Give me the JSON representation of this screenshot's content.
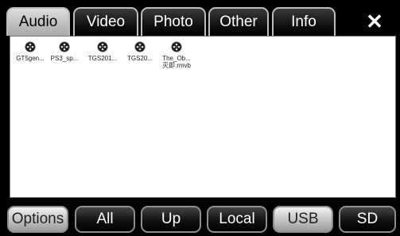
{
  "tabs": [
    {
      "label": "Audio",
      "active": true
    },
    {
      "label": "Video",
      "active": false
    },
    {
      "label": "Photo",
      "active": false
    },
    {
      "label": "Other",
      "active": false
    },
    {
      "label": "Info",
      "active": false
    }
  ],
  "close_label": "✕",
  "files": [
    {
      "name": "GT5gen..."
    },
    {
      "name": "PS3_sp..."
    },
    {
      "name": "TGS201..."
    },
    {
      "name": "TGS20..."
    },
    {
      "name": "The_Ob...",
      "name_line2": "灭即.rmvb"
    }
  ],
  "bottom_buttons": [
    {
      "label": "Options"
    },
    {
      "label": "All"
    },
    {
      "label": "Up"
    },
    {
      "label": "Local"
    },
    {
      "label": "USB"
    },
    {
      "label": "SD"
    }
  ],
  "colors": {
    "accent_tab": "#b9b9b9",
    "background": "#000000",
    "panel": "#ffffff"
  }
}
